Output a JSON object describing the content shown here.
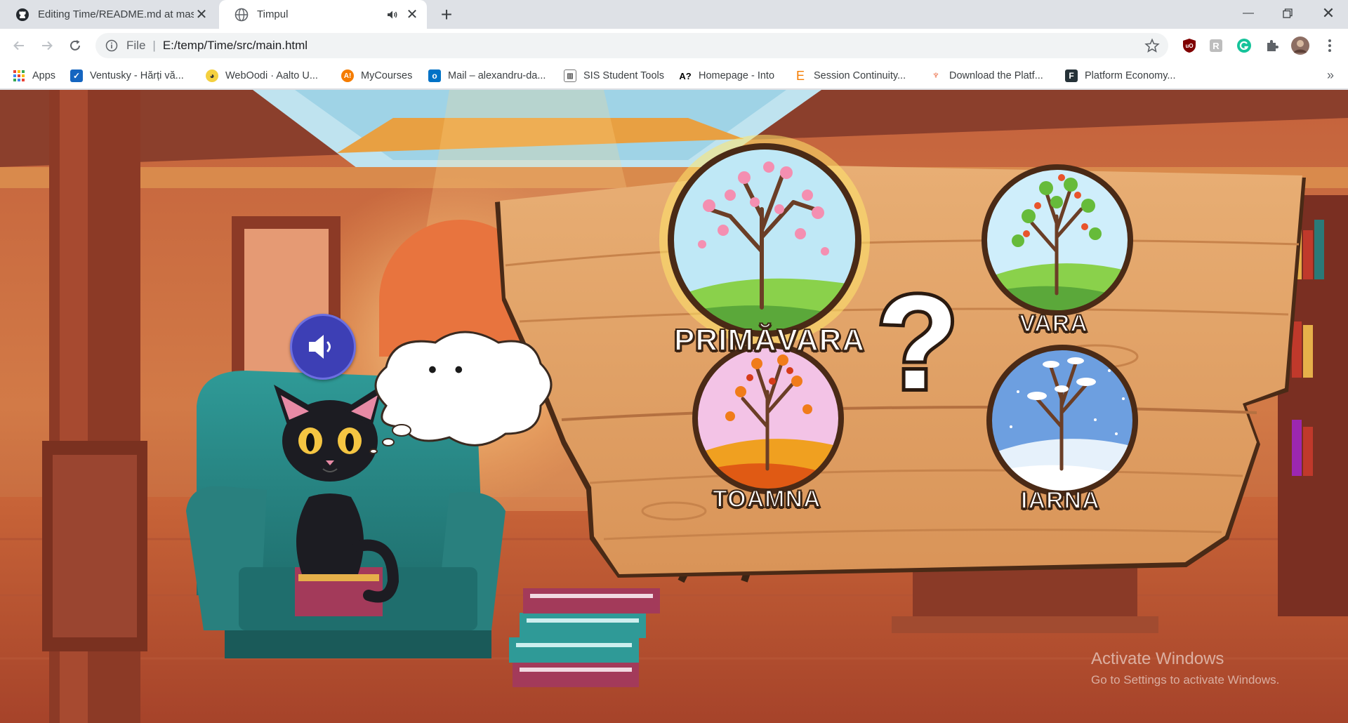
{
  "browser": {
    "tabs": [
      {
        "title": "Editing Time/README.md at mas",
        "icon": "github-icon"
      },
      {
        "title": "Timpul",
        "icon": "globe-icon",
        "muted_indicator": "speaker-icon"
      }
    ],
    "new_tab_label": "+",
    "address": {
      "scheme": "File",
      "separator": "|",
      "url": "E:/temp/Time/src/main.html"
    },
    "bookmarks": [
      {
        "label": "Apps",
        "icon": "apps-grid-icon"
      },
      {
        "label": "Ventusky - Hărți vă...",
        "icon": "ventusky-icon"
      },
      {
        "label": "WebOodi · Aalto U...",
        "icon": "weboodi-icon"
      },
      {
        "label": "MyCourses",
        "icon": "mycourses-icon"
      },
      {
        "label": "Mail – alexandru-da...",
        "icon": "outlook-icon"
      },
      {
        "label": "SIS Student Tools",
        "icon": "sis-icon"
      },
      {
        "label": "Homepage - Into",
        "icon": "into-icon"
      },
      {
        "label": "Session Continuity...",
        "icon": "session-icon"
      },
      {
        "label": "Download the Platf...",
        "icon": "download-icon"
      },
      {
        "label": "Platform Economy...",
        "icon": "platform-icon"
      }
    ],
    "more_bookmarks": "»"
  },
  "game": {
    "bubble_text": "• •",
    "seasons": [
      {
        "label": "PRIMĂVARA",
        "theme": "spring"
      },
      {
        "label": "VARA",
        "theme": "summer"
      },
      {
        "label": "TOAMNA",
        "theme": "autumn"
      },
      {
        "label": "IARNA",
        "theme": "winter"
      }
    ],
    "question_mark": "?"
  },
  "os_watermark": {
    "line1": "Activate Windows",
    "line2": "Go to Settings to activate Windows."
  },
  "colors": {
    "accent_sound_button": "#3d3fb5",
    "wood": "#e0a468",
    "chair": "#2a8a88"
  }
}
